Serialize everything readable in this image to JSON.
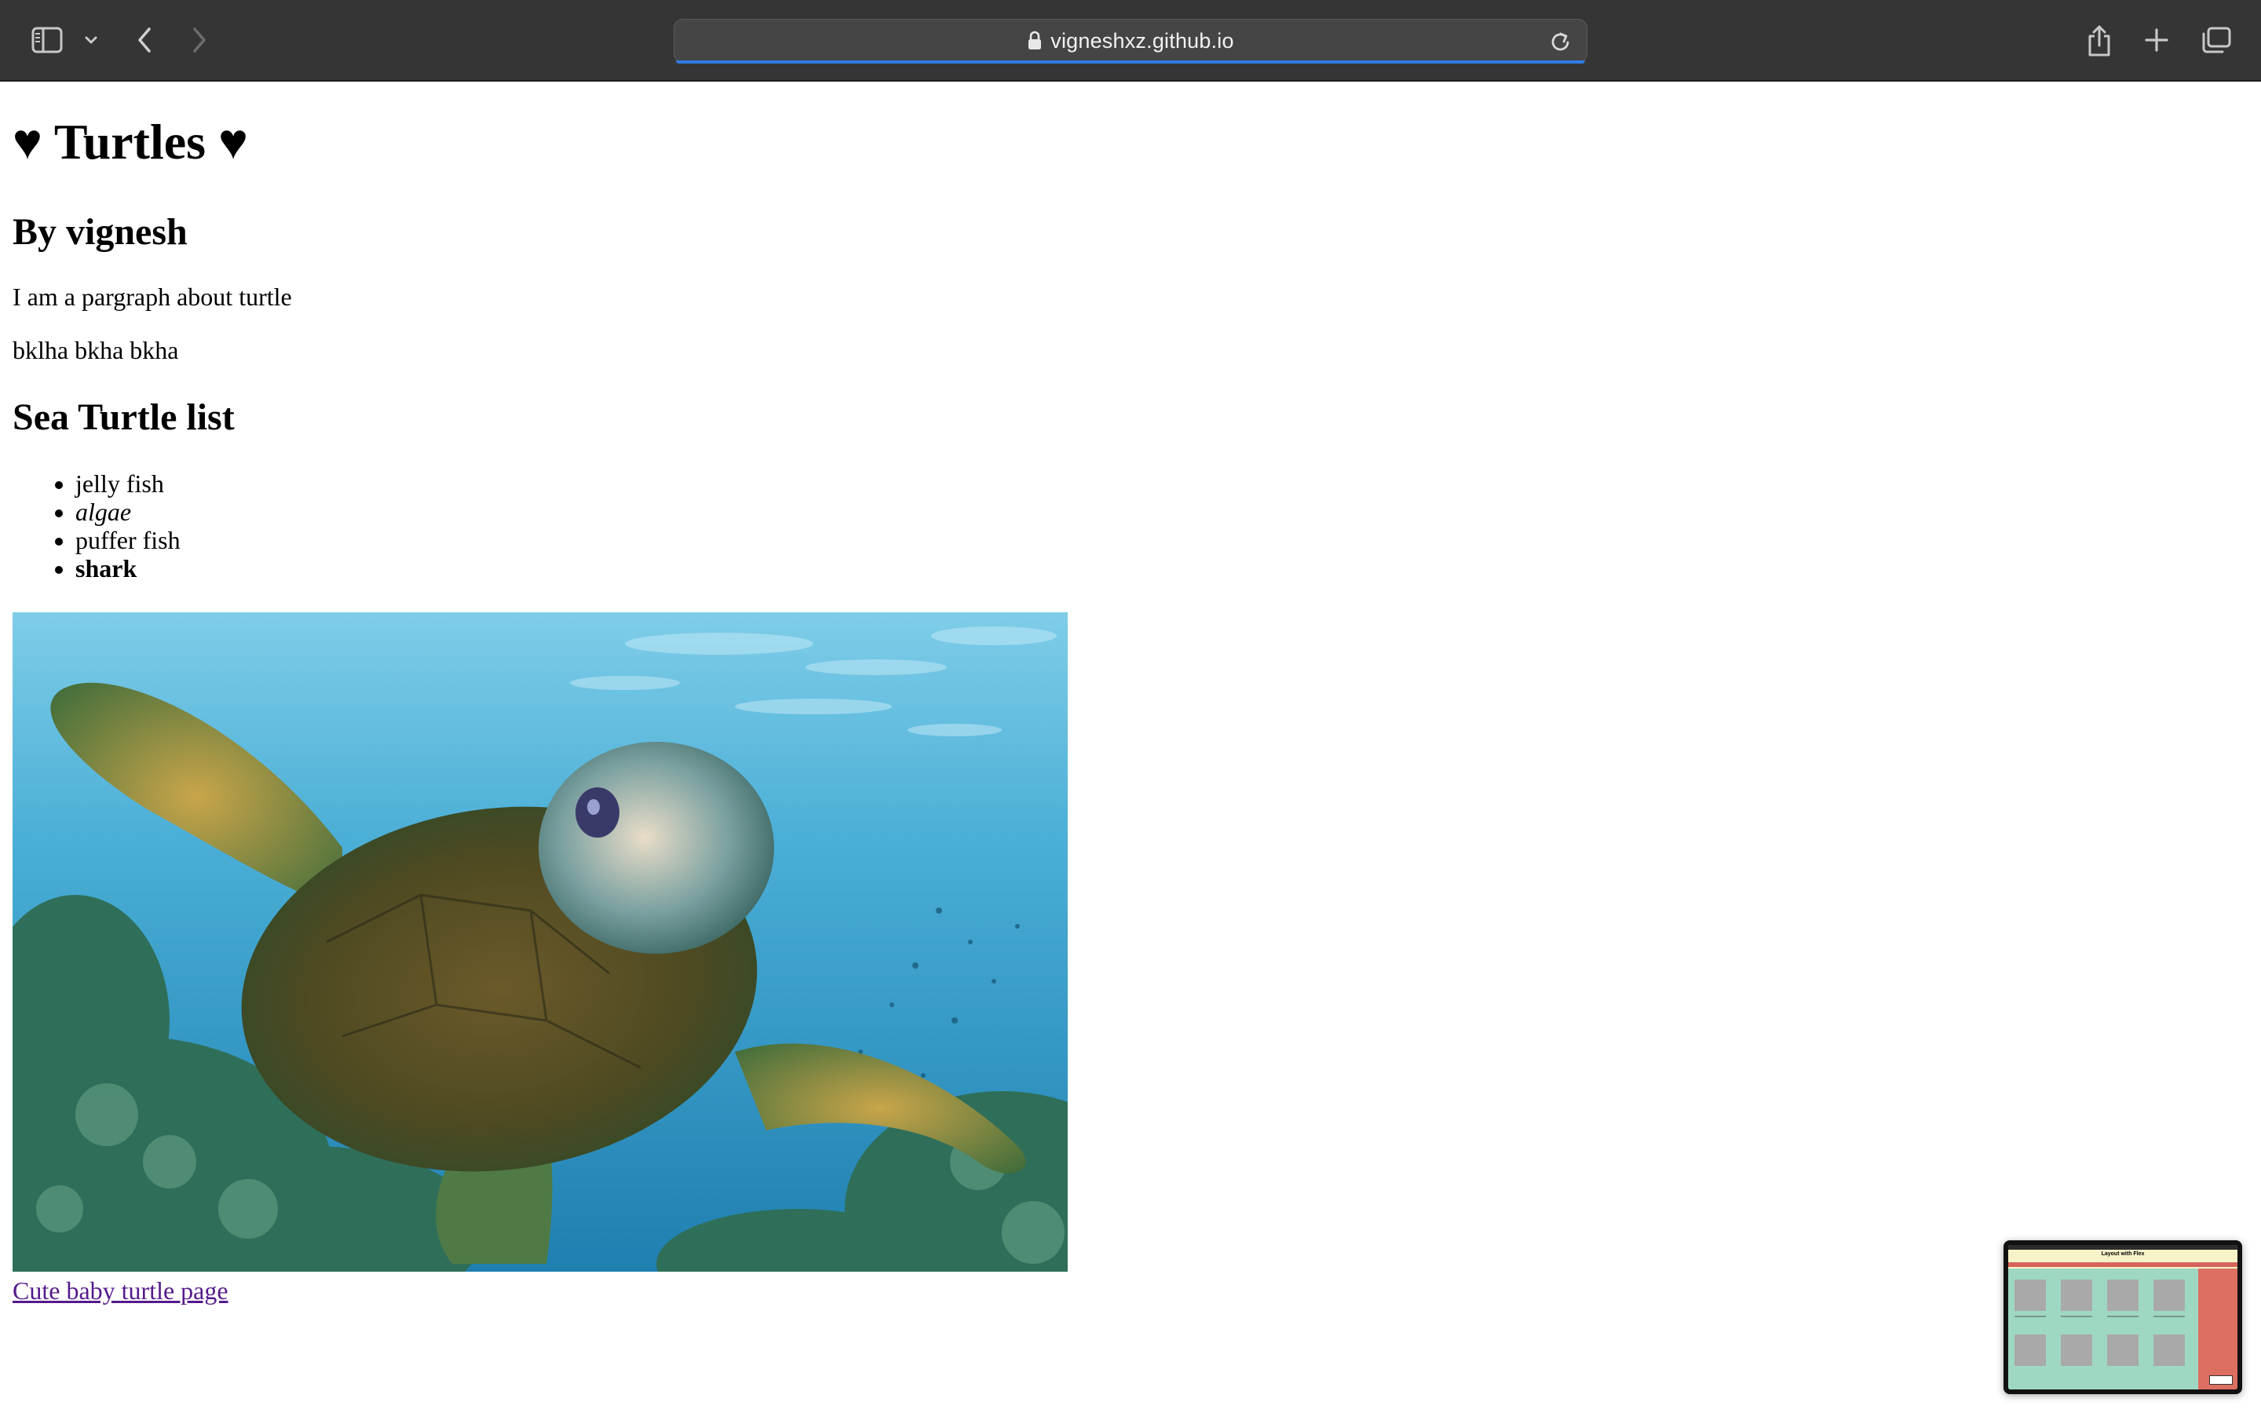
{
  "browser": {
    "url": "vigneshxz.github.io",
    "icons": {
      "sidebar": "sidebar-icon",
      "sidebar_menu": "chevron-down-icon",
      "back": "chevron-left-icon",
      "forward": "chevron-right-icon",
      "lock": "lock-icon",
      "reload": "reload-icon",
      "share": "share-icon",
      "new_tab": "plus-icon",
      "tab_overview": "tabs-icon"
    },
    "accent_color": "#2f7ce6"
  },
  "page": {
    "title": "♥ Turtles ♥",
    "byline": "By vignesh",
    "paragraphs": [
      "I am a pargraph about turtle",
      "bklha bkha bkha"
    ],
    "list_heading": "Sea Turtle list",
    "list_items": [
      {
        "text": "jelly fish",
        "style": "normal"
      },
      {
        "text": "algae",
        "style": "italic"
      },
      {
        "text": "puffer fish",
        "style": "normal"
      },
      {
        "text": "shark",
        "style": "bold"
      }
    ],
    "image_subject": "sea-turtle-photo",
    "link_text": "Cute baby turtle page",
    "link_color": "#551a8b"
  },
  "thumbnail": {
    "title": "Layout with Flex"
  }
}
